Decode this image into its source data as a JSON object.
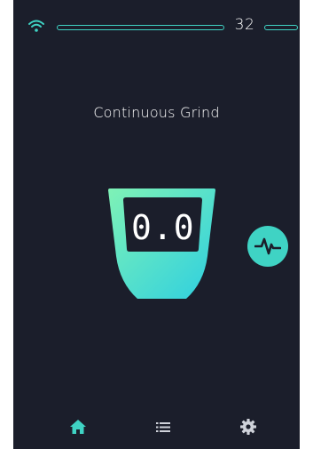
{
  "status": {
    "temperature": "32",
    "wifi_icon": "wifi-icon"
  },
  "main": {
    "mode_title": "Continuous Grind",
    "weight_value": "0.0"
  },
  "nav": {
    "items": [
      {
        "icon": "home-icon",
        "active": true
      },
      {
        "icon": "list-icon",
        "active": false
      },
      {
        "icon": "gear-icon",
        "active": false
      }
    ]
  },
  "colors": {
    "background": "#1b1e2b",
    "accent": "#3fd3c4",
    "gradient_start": "#7ff2b6",
    "gradient_end": "#2ecfe0",
    "icon_muted": "#cfd2da",
    "text": "#ffffff"
  }
}
